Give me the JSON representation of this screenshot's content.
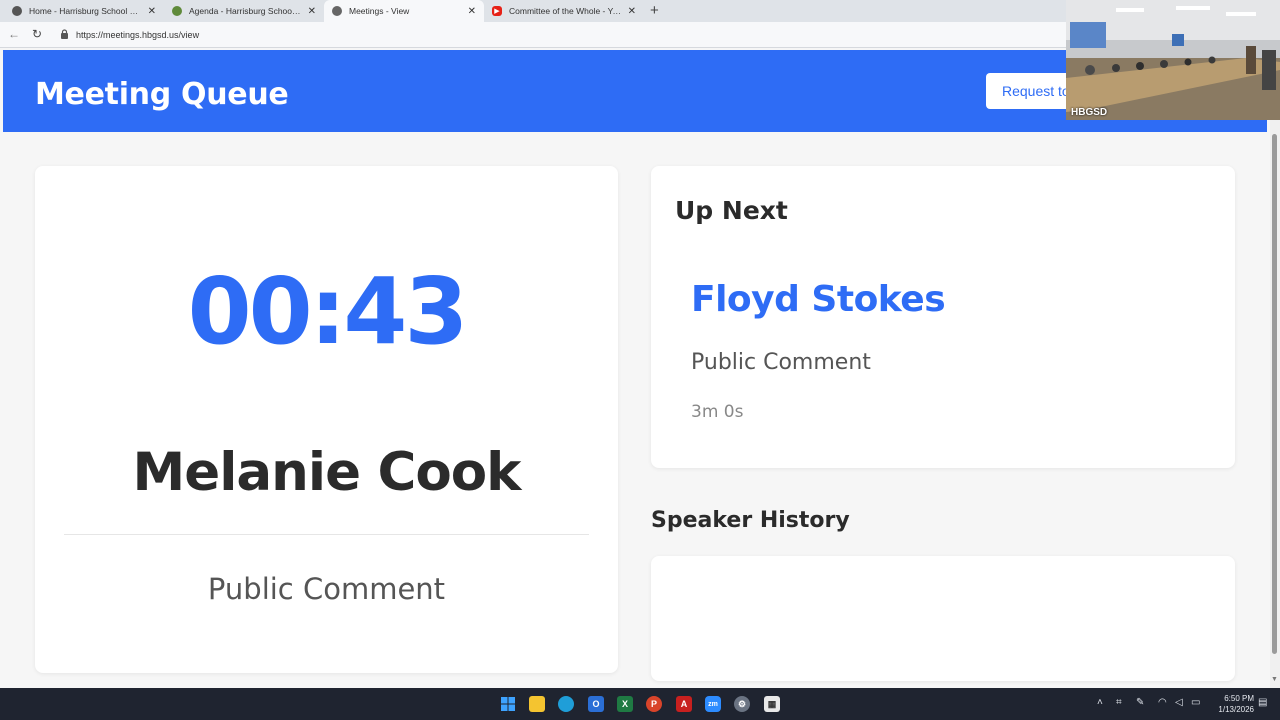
{
  "browser": {
    "tabs": [
      {
        "title": "Home - Harrisburg School Distric",
        "icon": "school-logo-icon",
        "active": false
      },
      {
        "title": "Agenda - Harrisburg School Distr",
        "icon": "leaf-icon",
        "active": false
      },
      {
        "title": "Meetings - View",
        "icon": "globe-icon",
        "active": true
      },
      {
        "title": "Committee of the Whole - YouTu",
        "icon": "youtube-icon",
        "active": false
      }
    ],
    "url": "https://meetings.hbgsd.us/view"
  },
  "header": {
    "title": "Meeting Queue",
    "request_button": "Request to",
    "color": "#2e6cf5"
  },
  "current_speaker": {
    "timer": "00:43",
    "name": "Melanie Cook",
    "type": "Public Comment"
  },
  "up_next": {
    "heading": "Up Next",
    "name": "Floyd Stokes",
    "type": "Public Comment",
    "duration": "3m 0s"
  },
  "speaker_history": {
    "heading": "Speaker History",
    "items": []
  },
  "video_overlay": {
    "label": "HBGSD"
  },
  "taskbar": {
    "time": "6:50 PM",
    "date": "1/13/2026"
  }
}
